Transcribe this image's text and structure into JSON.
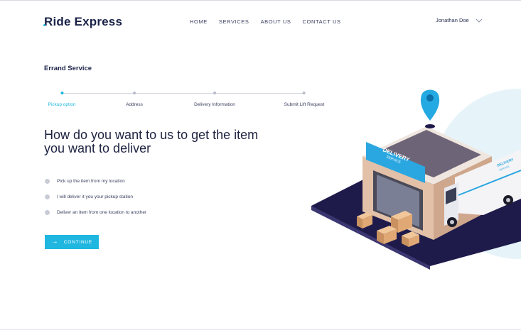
{
  "brand": {
    "logo": "Ride Express"
  },
  "nav": {
    "items": [
      "HOME",
      "SERVICES",
      "ABOUT US",
      "CONTACT US"
    ]
  },
  "user": {
    "name": "Jonathan Doe",
    "menu_icon": "chevron-down-icon"
  },
  "page": {
    "section_title": "Errand Service",
    "headline": "How do you want to us to get the item you want to deliver"
  },
  "stepper": {
    "steps": [
      {
        "label": "Pickup option",
        "active": true
      },
      {
        "label": "Address",
        "active": false
      },
      {
        "label": "Delivery Information",
        "active": false
      },
      {
        "label": "Submit Lift Request",
        "active": false
      }
    ]
  },
  "options": [
    "Pick up the item from my location",
    "I will deliver it you your pickup station",
    "Deliver an item from one location to another"
  ],
  "cta": {
    "label": "CONTINUE",
    "icon": "arrow-right-icon"
  },
  "illustration": {
    "banner_text": [
      "DELIVERY",
      "SERVICE"
    ],
    "truck_text": [
      "DELIVERY",
      "SERVICE"
    ]
  },
  "colors": {
    "accent": "#1fb6e0",
    "text_dark": "#1d2340",
    "illustration_bg": "#e6f4fa",
    "road": "#1e1b4b"
  }
}
